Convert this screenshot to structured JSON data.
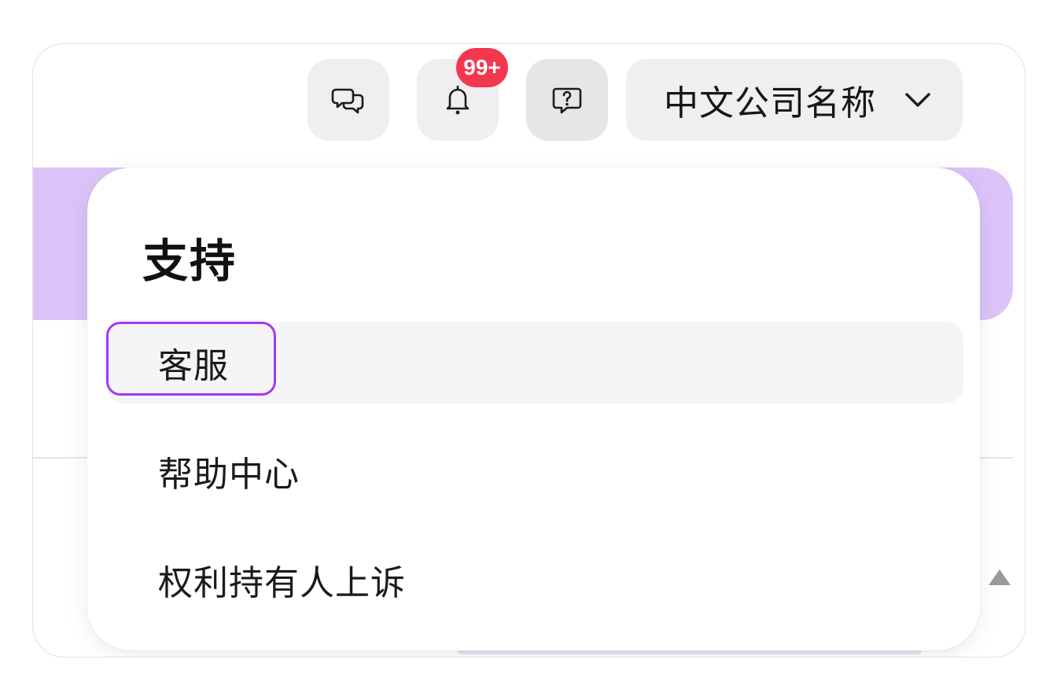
{
  "header": {
    "chat_button": {
      "icon": "chat-bubbles-icon"
    },
    "notifications_button": {
      "icon": "bell-icon",
      "badge": "99+"
    },
    "support_button": {
      "icon": "help-question-icon"
    },
    "account": {
      "name": "中文公司名称",
      "icon": "chevron-down-icon"
    }
  },
  "support_menu": {
    "title": "支持",
    "items": [
      {
        "label": "客服"
      },
      {
        "label": "帮助中心"
      },
      {
        "label": "权利持有人上诉"
      }
    ]
  },
  "colors": {
    "badge": "#f3374f",
    "focus_ring": "#a637f0",
    "banner": "#dcc4f9",
    "button_bg": "#efeff1"
  }
}
